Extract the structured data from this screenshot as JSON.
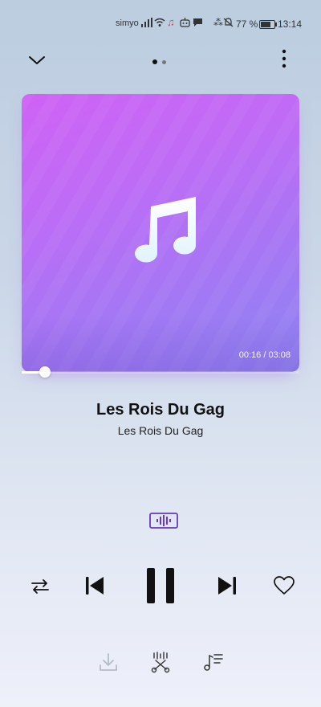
{
  "status_bar": {
    "carrier": "simyo",
    "battery_percent": "77 %",
    "battery_level": 0.77,
    "time": "13:14",
    "icons": [
      "signal-icon",
      "wifi-icon",
      "music-note-icon",
      "robot-icon",
      "chat-bubble-icon",
      "bluetooth-icon",
      "mute-icon",
      "battery-icon"
    ]
  },
  "header": {
    "pager_total": 2,
    "pager_active": 1
  },
  "player": {
    "elapsed": "00:16",
    "separator": " / ",
    "duration": "03:08",
    "time_display": "00:16 / 03:08",
    "progress_fraction": 0.085,
    "title": "Les Rois Du Gag",
    "artist": "Les Rois Du Gag",
    "is_playing": true,
    "liked": false
  },
  "colors": {
    "art_gradient_start": "#cf62f5",
    "art_gradient_end": "#8d86f2",
    "sound_effect_accent": "#6a3ab8",
    "controls": "#111111",
    "disabled": "#b4bcc8"
  },
  "icons": {
    "collapse": "chevron-down-icon",
    "more": "more-vertical-icon",
    "artwork": "music-note-icon",
    "sound_effect": "audio-waveform-icon",
    "repeat": "repeat-icon",
    "previous": "skip-previous-icon",
    "pause": "pause-icon",
    "next": "skip-next-icon",
    "favorite": "heart-icon",
    "download": "download-icon",
    "trim": "ringtone-cut-icon",
    "queue": "playlist-icon"
  }
}
